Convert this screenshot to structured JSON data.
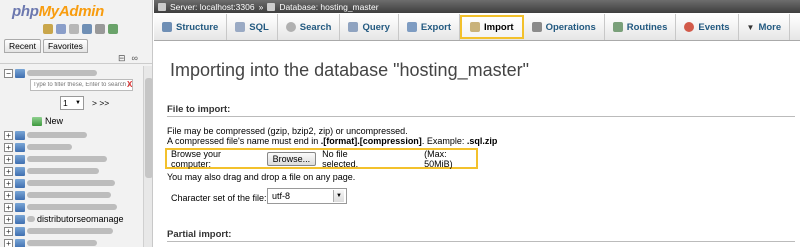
{
  "logo": {
    "part1": "php",
    "part2": "MyAdmin"
  },
  "nav_icons": [
    "home-icon",
    "exit-icon",
    "query-window-icon",
    "docs-icon",
    "settings-icon",
    "reload-icon"
  ],
  "nav_tabs": [
    "Recent",
    "Favorites"
  ],
  "collapse_controls": {
    "collapse": "⊟",
    "link": "∞"
  },
  "filter": {
    "placeholder": "Type to filter these, Enter to search all",
    "clear": "X"
  },
  "pagination": {
    "page": "1",
    "next": "> >>"
  },
  "new_item": "New",
  "visible_db_names": [
    "distributorseomanage"
  ],
  "breadcrumb": {
    "server": "Server: localhost:3306",
    "separator": "»",
    "database": "Database: hosting_master"
  },
  "tabs": [
    {
      "label": "Structure",
      "icon": "structure-icon",
      "active": false
    },
    {
      "label": "SQL",
      "icon": "sql-icon",
      "active": false
    },
    {
      "label": "Search",
      "icon": "search-icon",
      "active": false
    },
    {
      "label": "Query",
      "icon": "query-icon",
      "active": false
    },
    {
      "label": "Export",
      "icon": "export-icon",
      "active": false
    },
    {
      "label": "Import",
      "icon": "import-icon",
      "active": true
    },
    {
      "label": "Operations",
      "icon": "operations-icon",
      "active": false
    },
    {
      "label": "Routines",
      "icon": "routines-icon",
      "active": false
    },
    {
      "label": "Events",
      "icon": "events-icon",
      "active": false
    },
    {
      "label": "More",
      "icon": "more-icon",
      "active": false
    }
  ],
  "main": {
    "title": "Importing into the database \"hosting_master\"",
    "file_section": {
      "heading": "File to import:",
      "line1": "File may be compressed (gzip, bzip2, zip) or uncompressed.",
      "line2_prefix": "A compressed file's name must end in ",
      "line2_format": ".[format].[compression]",
      "line2_mid": ". Example: ",
      "line2_example": ".sql.zip",
      "browse_label": "Browse your computer:",
      "browse_button": "Browse...",
      "file_status": "No file selected.",
      "max_size": "(Max: 50MiB)",
      "drag_drop": "You may also drag and drop a file on any page.",
      "charset_label": "Character set of the file:",
      "charset_value": "utf-8"
    },
    "partial_section": {
      "heading": "Partial import:"
    }
  },
  "colors": {
    "highlight": "#f3c12c",
    "link": "#235a81",
    "topbar": "#4e4e4e"
  }
}
